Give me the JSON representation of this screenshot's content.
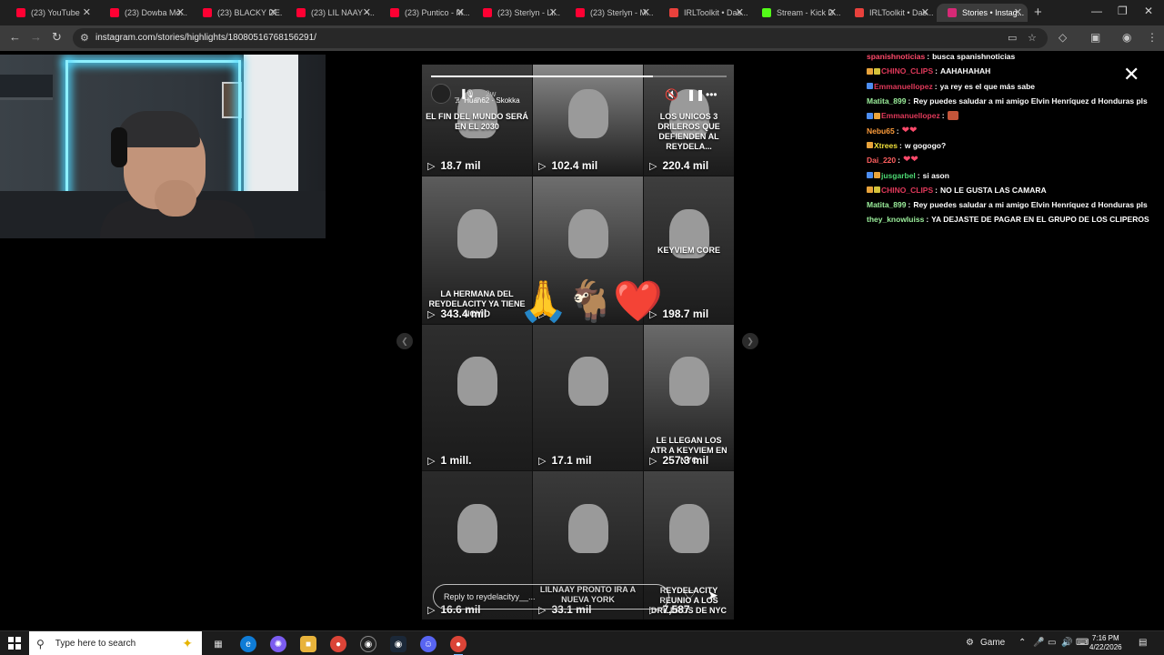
{
  "browser": {
    "tabs": [
      {
        "title": "(23) YouTube",
        "favicon_color": "#ff0033"
      },
      {
        "title": "(23) Dowba Mo...",
        "favicon_color": "#ff0033"
      },
      {
        "title": "(23) BLACKY DE...",
        "favicon_color": "#ff0033"
      },
      {
        "title": "(23) LIL NAAY -...",
        "favicon_color": "#ff0033"
      },
      {
        "title": "(23) Puntico - M...",
        "favicon_color": "#ff0033"
      },
      {
        "title": "(23) Sterlyn - Li...",
        "favicon_color": "#ff0033"
      },
      {
        "title": "(23) Sterlyn - M...",
        "favicon_color": "#ff0033"
      },
      {
        "title": "IRLToolkit • Das...",
        "favicon_color": "#e8413c"
      },
      {
        "title": "Stream - Kick D...",
        "favicon_color": "#53fc18"
      },
      {
        "title": "IRLToolkit • Das...",
        "favicon_color": "#e8413c"
      },
      {
        "title": "Stories • Instag...",
        "favicon_color": "#d62976",
        "active": true
      }
    ],
    "url": "instagram.com/stories/highlights/18080516768156291/"
  },
  "story": {
    "username": "_▐🎙_",
    "time_ago": "2w",
    "music": "Huan62 · Skokka",
    "progress": 0.75,
    "reply_placeholder": "Reply to reydelacityy__...",
    "grid": [
      {
        "caption": "EL FIN DEL MUNDO SERÁ EN EL 2030",
        "views": "18.7 mil"
      },
      {
        "caption": "",
        "views": "102.4 mil"
      },
      {
        "caption": "LOS UNICOS 3 DRILEROS QUE DEFIENDEN AL REYDELA...",
        "views": "220.4 mil"
      },
      {
        "caption": "LA HERMANA DEL REYDELACITY YA TIENE NOVIO",
        "views": "343.4 mil"
      },
      {
        "caption": "",
        "views": "8"
      },
      {
        "caption": "KEYVIEM CORE",
        "views": "198.7 mil"
      },
      {
        "caption": "",
        "views": "1 mill."
      },
      {
        "caption": "",
        "views": "17.1 mil"
      },
      {
        "caption": "LE LLEGAN LOS ATR A KEYVIEM EN NYC",
        "views": "257.3 mil"
      },
      {
        "caption": "",
        "views": "16.6 mil"
      },
      {
        "caption": "LILNAAY PRONTO IRA A NUEVA YORK",
        "views": "33.1 mil"
      },
      {
        "caption": "REYDELACITY REUNIO A LOS DRILEROS DE NYC",
        "views": "7,587"
      }
    ],
    "stickers": [
      "🙏",
      "🐐",
      "❤️"
    ]
  },
  "chat": {
    "messages": [
      {
        "user": "spanishnoticias",
        "color": "#ff4a6b",
        "badges": [],
        "text": "busca spanishnoticias"
      },
      {
        "user": "CHINO_CLIPS",
        "color": "#e0395a",
        "badges": [
          "#e8a33b",
          "#d4c23a"
        ],
        "text": "AAHAHAHAH"
      },
      {
        "user": "Emmanuellopez",
        "color": "#e0395a",
        "badges": [
          "#4d8ef2"
        ],
        "text": "ya rey es el que más sabe"
      },
      {
        "user": "Matita_899",
        "color": "#9cf09c",
        "badges": [],
        "text": "Rey puedes saludar a mi amigo Elvin Henríquez d Honduras pls"
      },
      {
        "user": "Emmanuellopez",
        "color": "#e0395a",
        "badges": [
          "#4d8ef2",
          "#e8a33b"
        ],
        "text": "",
        "emote": "box"
      },
      {
        "user": "Nebu65",
        "color": "#ff9d3b",
        "badges": [],
        "text": "",
        "emote": "heart"
      },
      {
        "user": "Xtrees",
        "color": "#f0e03b",
        "badges": [
          "#e8a33b"
        ],
        "text": "w gogogo?"
      },
      {
        "user": "Dai_220",
        "color": "#ff5f5f",
        "badges": [],
        "text": "",
        "emote": "heart"
      },
      {
        "user": "jusgarbel",
        "color": "#4dd873",
        "badges": [
          "#4d8ef2",
          "#e8a33b"
        ],
        "text": "si ason"
      },
      {
        "user": "CHINO_CLIPS",
        "color": "#e0395a",
        "badges": [
          "#e8a33b",
          "#d4c23a"
        ],
        "text": "NO LE GUSTA LAS CAMARA"
      },
      {
        "user": "Matita_899",
        "color": "#9cf09c",
        "badges": [],
        "text": "Rey puedes saludar a mi amigo Elvin Henríquez d Honduras pls"
      },
      {
        "user": "they_knowluiss",
        "color": "#9cf09c",
        "badges": [],
        "text": "YA DEJASTE DE PAGAR EN EL GRUPO DE LOS CLIPEROS"
      }
    ]
  },
  "taskbar": {
    "search_placeholder": "Type here to search",
    "game_label": "Game",
    "time": "7:16 PM",
    "date": "4/22/2026"
  }
}
